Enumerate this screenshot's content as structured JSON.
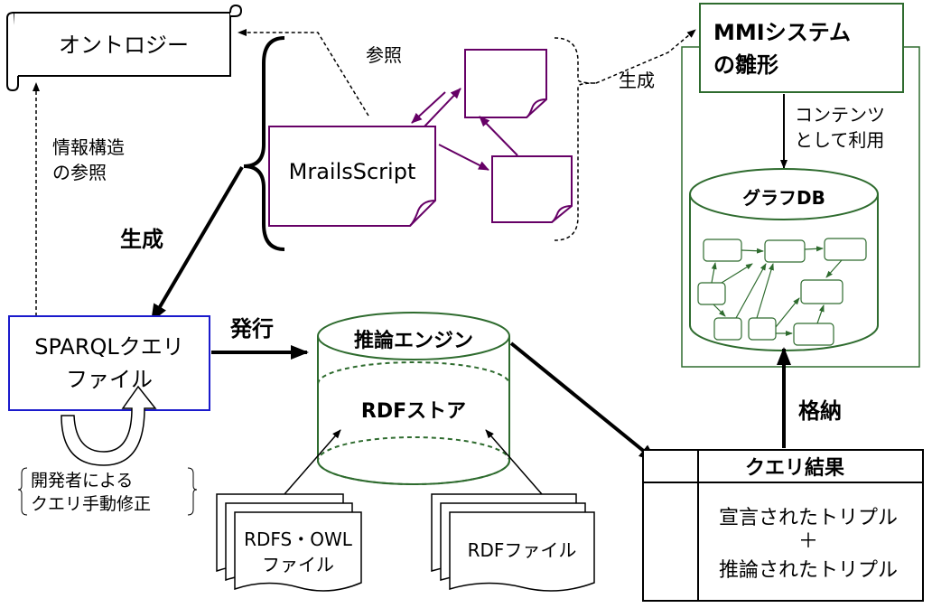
{
  "ontology": "オントロジー",
  "ref_info": [
    "情報構造",
    "の参照"
  ],
  "sparql": [
    "SPARQLクエリ",
    "ファイル"
  ],
  "dev_edit": [
    "開発者による",
    "クエリ手動修正"
  ],
  "generate_left": "生成",
  "mrails": "MrailsScript",
  "reference_top": "参照",
  "generate_right": "生成",
  "mmi": [
    "MMIシステム",
    "の雛形"
  ],
  "content_use": [
    "コンテンツ",
    "として利用"
  ],
  "graph_db": "グラフDB",
  "issue": "発行",
  "engine": "推論エンジン",
  "rdf_store": "RDFストア",
  "rdfs_owl": [
    "RDFS・OWL",
    "ファイル"
  ],
  "rdf_file": "RDFファイル",
  "store": "格納",
  "query_result": "クエリ結果",
  "triples": [
    "宣言されたトリプル",
    "＋",
    "推論されたトリプル"
  ],
  "colors": {
    "purple": "#660066",
    "blue": "#1a1acc",
    "green": "#2e6b2e",
    "black": "#000000"
  }
}
